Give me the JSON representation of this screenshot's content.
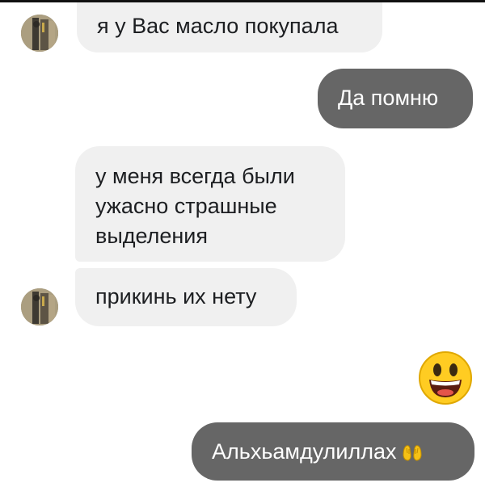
{
  "conversation": {
    "messages": [
      {
        "direction": "incoming",
        "text": "я у Вас масло покупала"
      },
      {
        "direction": "outgoing",
        "text": "Да помню"
      },
      {
        "direction": "incoming",
        "text": "у меня всегда были\nужасно страшные\nвыделения"
      },
      {
        "direction": "incoming",
        "text": "прикинь их нету"
      },
      {
        "direction": "outgoing",
        "emoji": "grinning-face-big-eyes"
      },
      {
        "direction": "outgoing",
        "text": "Альхьамдулиллах",
        "emoji": "palms-up-together"
      }
    ]
  },
  "colors": {
    "incoming_bubble": "#f0f0f0",
    "outgoing_bubble": "#666666",
    "outgoing_text": "#ffffff",
    "incoming_text": "#1c1e21"
  }
}
